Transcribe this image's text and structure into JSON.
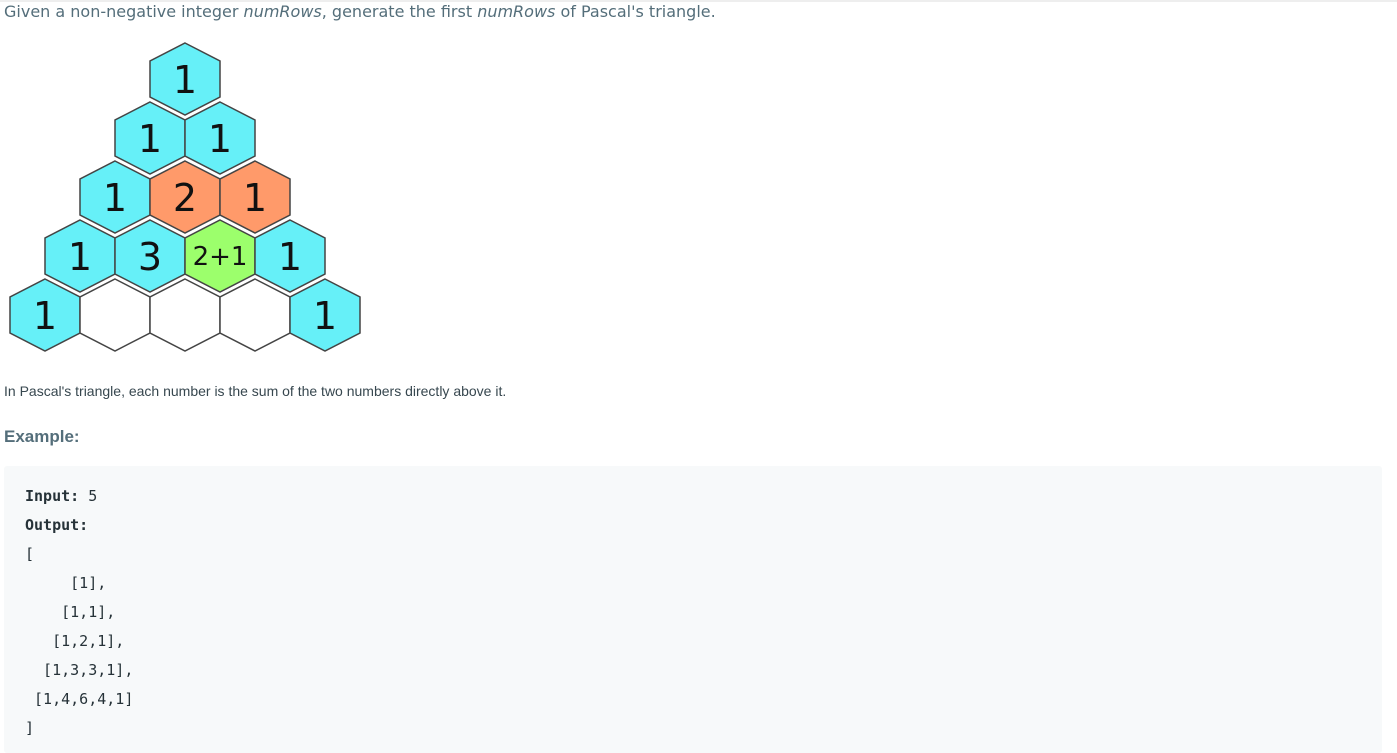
{
  "intro": {
    "prefix": "Given a non-negative integer ",
    "var1": "numRows",
    "middle": ", generate the first ",
    "var2": "numRows",
    "suffix": " of Pascal's triangle."
  },
  "figure": {
    "colors": {
      "cyan": "#66f0f8",
      "orange": "#ff9a6a",
      "green": "#9cff6c",
      "white": "#ffffff",
      "stroke": "#444444"
    },
    "rows": [
      [
        {
          "text": "1",
          "color": "cyan"
        }
      ],
      [
        {
          "text": "1",
          "color": "cyan"
        },
        {
          "text": "1",
          "color": "cyan"
        }
      ],
      [
        {
          "text": "1",
          "color": "cyan"
        },
        {
          "text": "2",
          "color": "orange"
        },
        {
          "text": "1",
          "color": "orange"
        }
      ],
      [
        {
          "text": "1",
          "color": "cyan"
        },
        {
          "text": "3",
          "color": "cyan"
        },
        {
          "text": "2+1",
          "color": "green"
        },
        {
          "text": "1",
          "color": "cyan"
        }
      ],
      [
        {
          "text": "1",
          "color": "cyan"
        },
        {
          "text": "",
          "color": "white"
        },
        {
          "text": "",
          "color": "white"
        },
        {
          "text": "",
          "color": "white"
        },
        {
          "text": "1",
          "color": "cyan"
        }
      ]
    ]
  },
  "caption": "In Pascal's triangle, each number is the sum of the two numbers directly above it.",
  "example": {
    "heading": "Example:",
    "input_label": "Input:",
    "input_value": " 5",
    "output_label": "Output:",
    "open_bracket": "[",
    "rows": [
      "     [1],",
      "    [1,1],",
      "   [1,2,1],",
      "  [1,3,3,1],",
      " [1,4,6,4,1]"
    ],
    "close_bracket": "]"
  }
}
